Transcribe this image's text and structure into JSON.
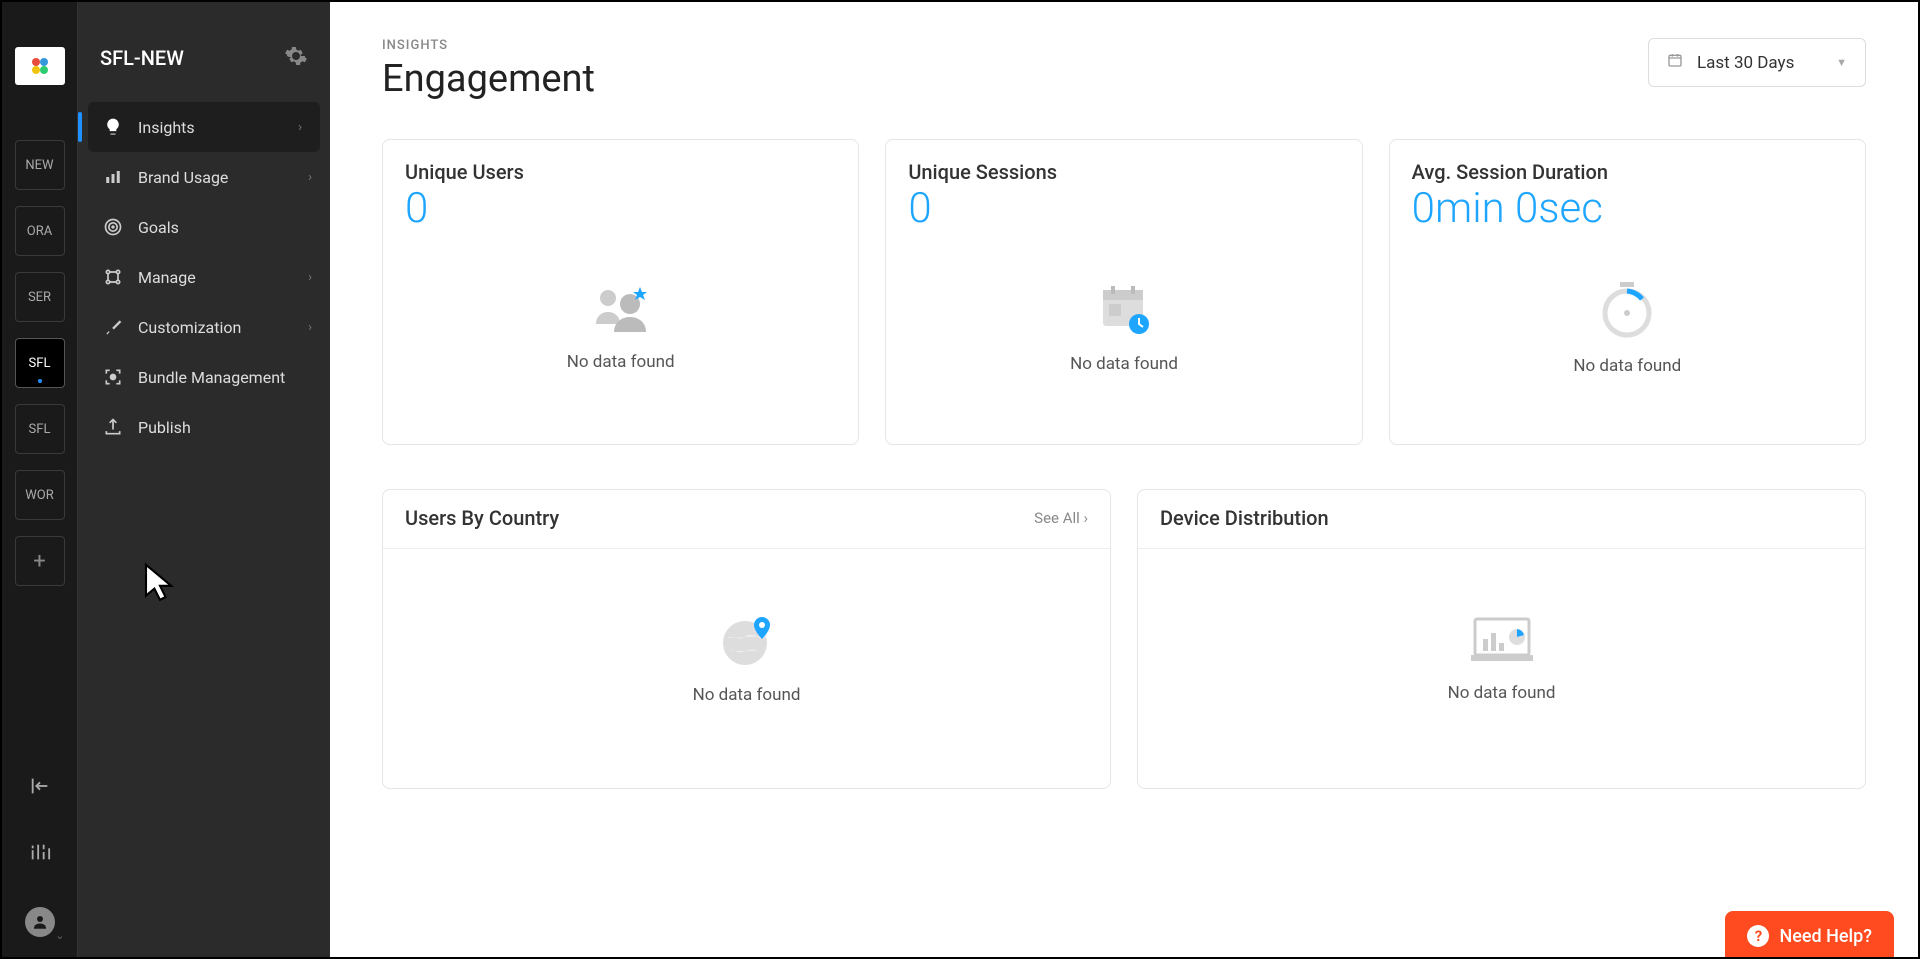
{
  "rail": {
    "tiles": [
      {
        "label": "NEW"
      },
      {
        "label": "ORA"
      },
      {
        "label": "SER"
      },
      {
        "label": "SFL",
        "active": true
      },
      {
        "label": "SFL"
      },
      {
        "label": "WOR"
      }
    ]
  },
  "sidebar": {
    "title": "SFL-NEW",
    "items": [
      {
        "label": "Insights",
        "icon": "bulb",
        "active": true,
        "expandable": true
      },
      {
        "label": "Brand Usage",
        "icon": "bars",
        "expandable": true
      },
      {
        "label": "Goals",
        "icon": "target",
        "expandable": false
      },
      {
        "label": "Manage",
        "icon": "nodes",
        "expandable": true
      },
      {
        "label": "Customization",
        "icon": "brush",
        "expandable": true
      },
      {
        "label": "Bundle Management",
        "icon": "scan",
        "expandable": false
      },
      {
        "label": "Publish",
        "icon": "upload",
        "expandable": false
      }
    ]
  },
  "page": {
    "crumb": "INSIGHTS",
    "title": "Engagement",
    "dateRange": "Last 30 Days"
  },
  "cards": {
    "uniqueUsers": {
      "title": "Unique Users",
      "value": "0",
      "empty": "No data found"
    },
    "uniqueSessions": {
      "title": "Unique Sessions",
      "value": "0",
      "empty": "No data found"
    },
    "avgSession": {
      "title": "Avg. Session Duration",
      "value": "0min 0sec",
      "empty": "No data found"
    },
    "usersByCountry": {
      "title": "Users By Country",
      "link": "See All  ›",
      "empty": "No data found"
    },
    "deviceDist": {
      "title": "Device Distribution",
      "empty": "No data found"
    }
  },
  "help": {
    "label": "Need Help?"
  }
}
